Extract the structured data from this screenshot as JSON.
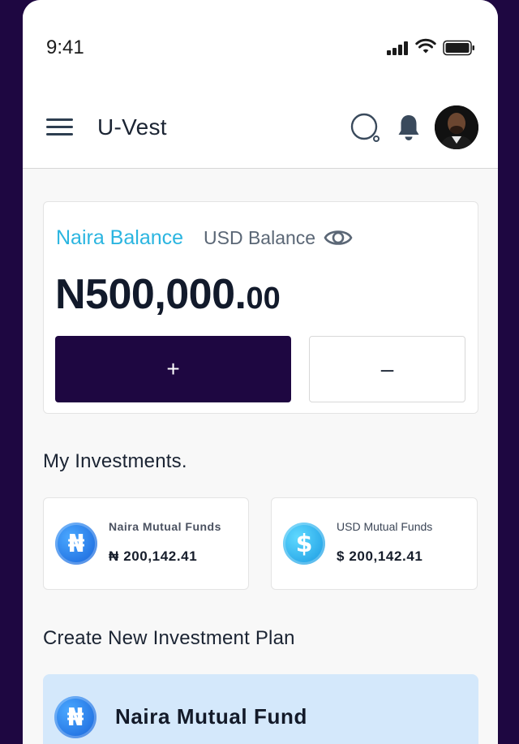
{
  "status_bar": {
    "time": "9:41"
  },
  "header": {
    "title": "U-Vest"
  },
  "balance": {
    "tab_naira": "Naira Balance",
    "tab_usd": "USD Balance",
    "amount_main": "N500,000.",
    "amount_cents": "00",
    "plus_label": "+",
    "minus_label": "–"
  },
  "investments": {
    "title": "My Investments.",
    "items": [
      {
        "name": "Naira Mutual Funds",
        "amount": "₦ 200,142.41",
        "icon": "naira-coin",
        "symbol": "₦"
      },
      {
        "name": "USD Mutual Funds",
        "amount": "$ 200,142.41",
        "icon": "dollar-coin",
        "symbol": "$"
      }
    ]
  },
  "create_plan": {
    "title": "Create New Investment Plan",
    "plans": [
      {
        "name": "Naira Mutual Fund",
        "icon": "naira-coin",
        "symbol": "₦"
      }
    ]
  },
  "colors": {
    "frame": "#1e0741",
    "accent": "#2bb5e0",
    "primary_button": "#1e0741",
    "plan_card_bg": "#d4e8fb"
  }
}
